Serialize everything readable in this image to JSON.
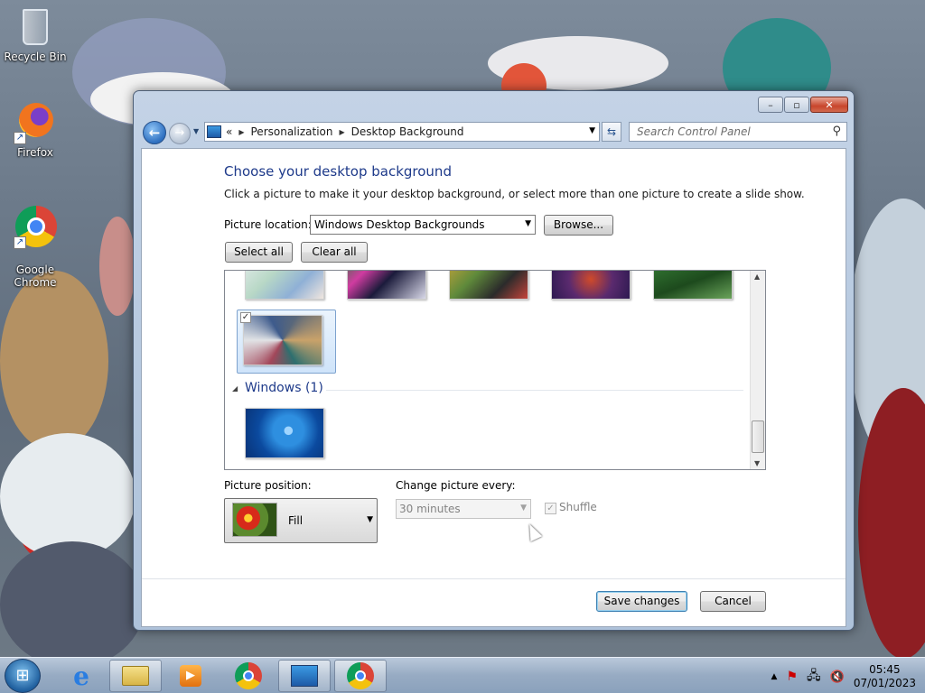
{
  "desktop": {
    "icons": [
      {
        "label": "Recycle Bin"
      },
      {
        "label": "Firefox"
      },
      {
        "label": "Google\nChrome"
      }
    ]
  },
  "window": {
    "caption_buttons": {
      "minimize": "–",
      "maximize": "▫",
      "close": "✕"
    },
    "address": {
      "crumbs": [
        "Personalization",
        "Desktop Background"
      ],
      "prefix": "«"
    },
    "search": {
      "placeholder": "Search Control Panel"
    },
    "heading": "Choose your desktop background",
    "subtext": "Click a picture to make it your desktop background, or select more than one picture to create a slide show.",
    "picture_location": {
      "label": "Picture location:",
      "value": "Windows Desktop Backgrounds"
    },
    "buttons": {
      "browse": "Browse...",
      "select_all": "Select all",
      "clear_all": "Clear all",
      "save": "Save changes",
      "cancel": "Cancel"
    },
    "gallery": {
      "group_title": "Windows (1)",
      "selected_check": "✓"
    },
    "picture_position": {
      "label": "Picture position:",
      "value": "Fill"
    },
    "change_every": {
      "label": "Change picture every:",
      "value": "30 minutes"
    },
    "shuffle": {
      "label": "Shuffle",
      "checked": true
    }
  },
  "taskbar": {
    "clock_time": "05:45",
    "clock_date": "07/01/2023",
    "tray_chevron": "▲"
  }
}
